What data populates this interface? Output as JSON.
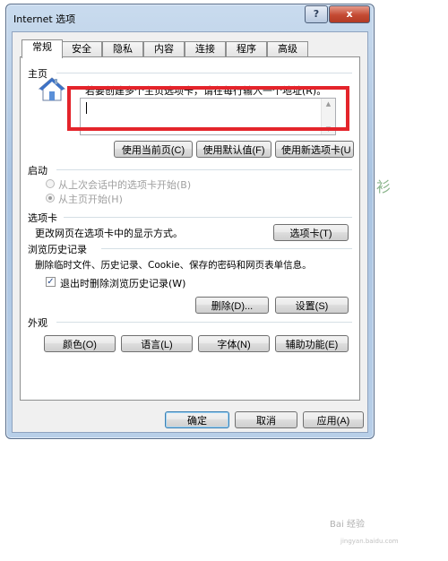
{
  "window": {
    "title": "Internet 选项",
    "help": "?",
    "close": "x"
  },
  "tabs": [
    "常规",
    "安全",
    "隐私",
    "内容",
    "连接",
    "程序",
    "高级"
  ],
  "home": {
    "section": "主页",
    "desc": "若要创建多个主页选项卡，请在每行输入一个地址(R)。",
    "btn_current": "使用当前页(C)",
    "btn_default": "使用默认值(F)",
    "btn_new_tab": "使用新选项卡(U"
  },
  "startup": {
    "section": "启动",
    "option1": "从上次会话中的选项卡开始(B)",
    "option2": "从主页开始(H)"
  },
  "tabs_section": {
    "section": "选项卡",
    "desc": "更改网页在选项卡中的显示方式。",
    "button": "选项卡(T)"
  },
  "history": {
    "section": "浏览历史记录",
    "desc": "删除临时文件、历史记录、Cookie、保存的密码和网页表单信息。",
    "checkbox": "退出时删除浏览历史记录(W)",
    "delete_btn": "删除(D)...",
    "settings_btn": "设置(S)"
  },
  "appearance": {
    "section": "外观",
    "colors": "颜色(O)",
    "languages": "语言(L)",
    "fonts": "字体(N)",
    "accessibility": "辅助功能(E)"
  },
  "footer": {
    "ok": "确定",
    "cancel": "取消",
    "apply": "应用(A)"
  },
  "side": {
    "text": "衫"
  },
  "watermark": {
    "text": "Bai 经验",
    "sub": "jingyan.baidu.com"
  }
}
